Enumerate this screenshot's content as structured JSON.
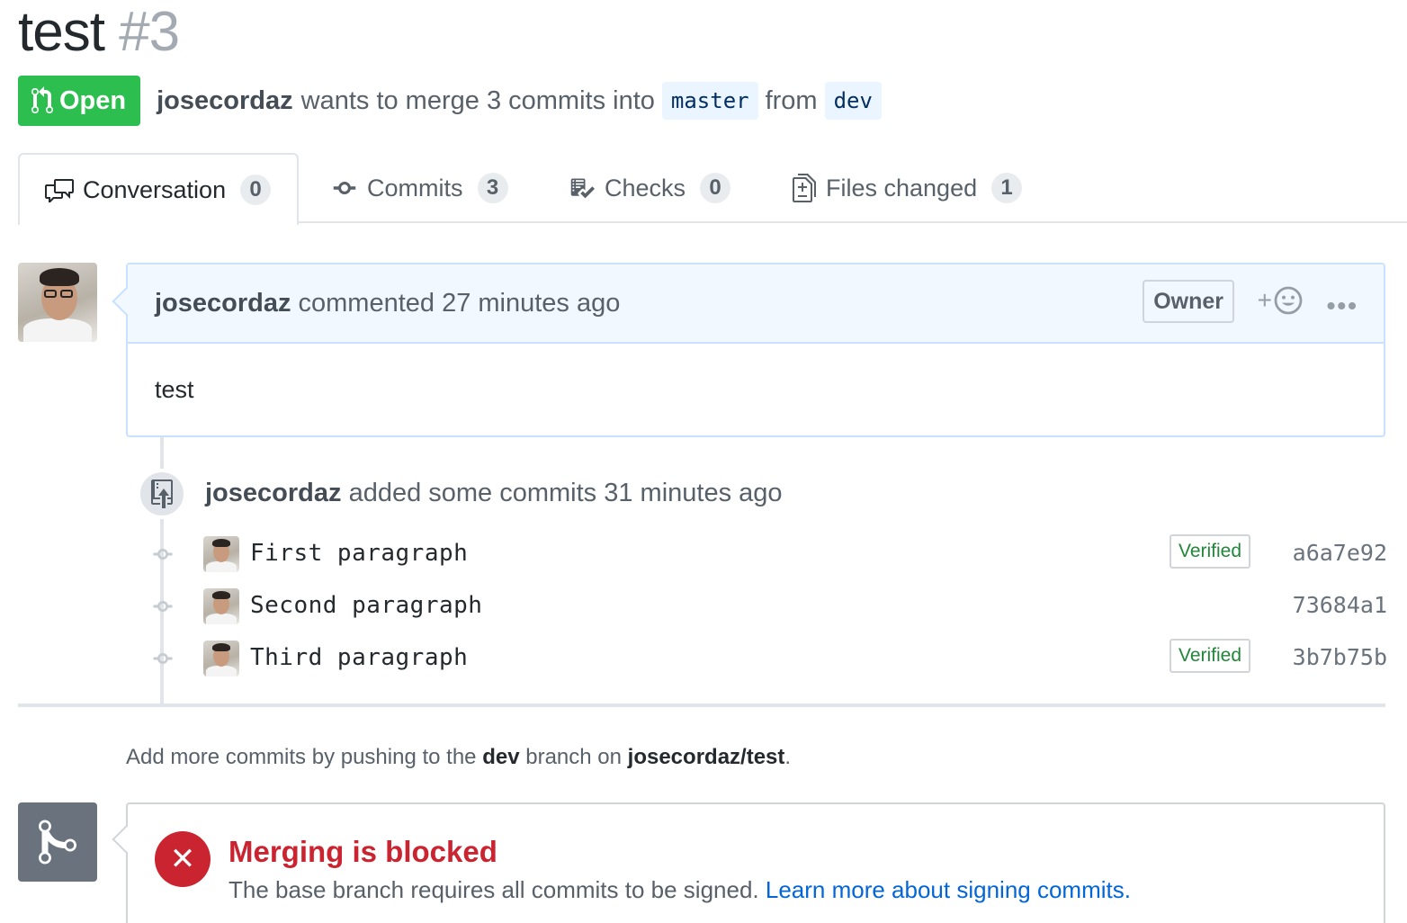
{
  "pr": {
    "title": "test",
    "number": "#3"
  },
  "status": {
    "state": "Open",
    "author": "josecordaz",
    "text": "wants to merge 3 commits into",
    "base_branch": "master",
    "from_text": "from",
    "head_branch": "dev"
  },
  "tabs": [
    {
      "label": "Conversation",
      "count": "0",
      "icon": "comment-discussion-icon"
    },
    {
      "label": "Commits",
      "count": "3",
      "icon": "git-commit-icon"
    },
    {
      "label": "Checks",
      "count": "0",
      "icon": "checklist-icon"
    },
    {
      "label": "Files changed",
      "count": "1",
      "icon": "diff-icon"
    }
  ],
  "comment": {
    "author": "josecordaz",
    "action": "commented 27 minutes ago",
    "label": "Owner",
    "reaction_plus": "+",
    "menu": "•••",
    "body": "test"
  },
  "push_event": {
    "author": "josecordaz",
    "text": "added some commits 31 minutes ago"
  },
  "commits": [
    {
      "message": "First paragraph",
      "verified": "Verified",
      "sha": "a6a7e92"
    },
    {
      "message": "Second paragraph",
      "verified": "",
      "sha": "73684a1"
    },
    {
      "message": "Third paragraph",
      "verified": "Verified",
      "sha": "3b7b75b"
    }
  ],
  "help": {
    "prefix": "Add more commits by pushing to the",
    "branch": "dev",
    "middle": "branch on",
    "repo": "josecordaz/test",
    "suffix": "."
  },
  "merge": {
    "icon_symbol": "✕",
    "title": "Merging is blocked",
    "description": "The base branch requires all commits to be signed.",
    "link": "Learn more about signing commits."
  },
  "colors": {
    "open_green": "#2cbe4e",
    "blocked_red": "#cb2431",
    "link_blue": "#0366d6",
    "comment_header_bg": "#f1f8ff"
  }
}
